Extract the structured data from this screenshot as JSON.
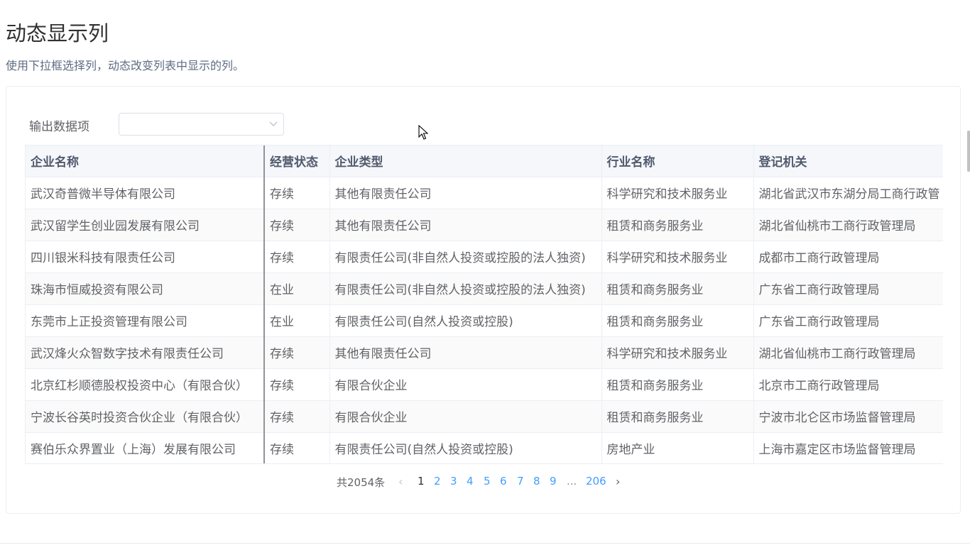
{
  "header": {
    "title": "动态显示列",
    "description": "使用下拉框选择列，动态改变列表中显示的列。"
  },
  "filter": {
    "label": "输出数据项",
    "selected": ""
  },
  "table": {
    "columns": [
      "企业名称",
      "经营状态",
      "企业类型",
      "行业名称",
      "登记机关"
    ],
    "rows": [
      [
        "武汉奇普微半导体有限公司",
        "存续",
        "其他有限责任公司",
        "科学研究和技术服务业",
        "湖北省武汉市东湖分局工商行政管"
      ],
      [
        "武汉留学生创业园发展有限公司",
        "存续",
        "其他有限责任公司",
        "租赁和商务服务业",
        "湖北省仙桃市工商行政管理局"
      ],
      [
        "四川银米科技有限责任公司",
        "存续",
        "有限责任公司(非自然人投资或控股的法人独资)",
        "科学研究和技术服务业",
        "成都市工商行政管理局"
      ],
      [
        "珠海市恒威投资有限公司",
        "在业",
        "有限责任公司(非自然人投资或控股的法人独资)",
        "租赁和商务服务业",
        "广东省工商行政管理局"
      ],
      [
        "东莞市上正投资管理有限公司",
        "在业",
        "有限责任公司(自然人投资或控股)",
        "租赁和商务服务业",
        "广东省工商行政管理局"
      ],
      [
        "武汉烽火众智数字技术有限责任公司",
        "存续",
        "其他有限责任公司",
        "科学研究和技术服务业",
        "湖北省仙桃市工商行政管理局"
      ],
      [
        "北京红杉顺德股权投资中心（有限合伙）",
        "存续",
        "有限合伙企业",
        "租赁和商务服务业",
        "北京市工商行政管理局"
      ],
      [
        "宁波长谷英时投资合伙企业（有限合伙）",
        "存续",
        "有限合伙企业",
        "租赁和商务服务业",
        "宁波市北仑区市场监督管理局"
      ],
      [
        "赛伯乐众界置业（上海）发展有限公司",
        "存续",
        "有限责任公司(自然人投资或控股)",
        "房地产业",
        "上海市嘉定区市场监督管理局"
      ]
    ]
  },
  "pagination": {
    "total_label": "共2054条",
    "pages": [
      "1",
      "2",
      "3",
      "4",
      "5",
      "6",
      "7",
      "8",
      "9"
    ],
    "current": "1",
    "ellipsis": "...",
    "last": "206"
  }
}
